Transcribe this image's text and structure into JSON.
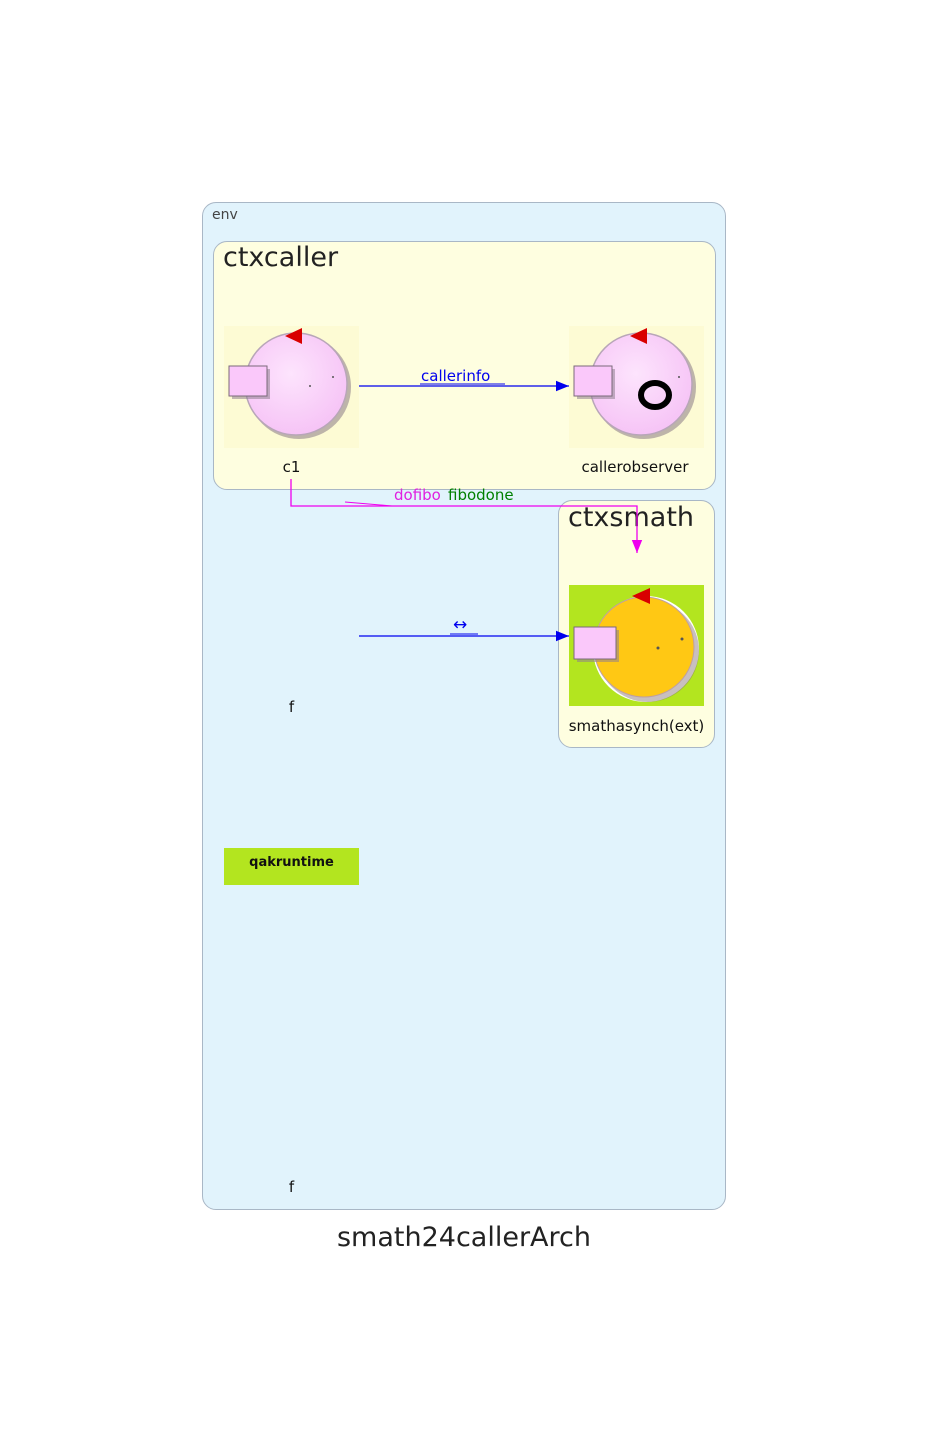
{
  "diagram": {
    "title": "smath24callerArch",
    "env": {
      "label": "env"
    },
    "contexts": [
      {
        "id": "ctxcaller",
        "label": "ctxcaller"
      },
      {
        "id": "ctxsmath",
        "label": "ctxsmath"
      }
    ],
    "nodes": {
      "c1": {
        "label": "c1"
      },
      "callerobserver": {
        "label": "callerobserver"
      },
      "smathasynch": {
        "label": "smathasynch(ext)"
      },
      "f1": {
        "label": "f"
      },
      "f2": {
        "label": "f"
      },
      "qakruntime": {
        "label": "qakruntime"
      }
    },
    "edges": {
      "callerinfo": {
        "label": "callerinfo",
        "color": "#0000ee"
      },
      "dofibo": {
        "label": "dofibo",
        "color": "#e020e0"
      },
      "fibodone": {
        "label": "fibodone",
        "color": "#008000"
      },
      "f_to_smath": {
        "label": "↔",
        "color": "#0000ee"
      }
    },
    "colors": {
      "env": "#e1f3fc",
      "context": "#fefee0",
      "actor_pink": "#fac8fa",
      "actor_external": "#ffc814",
      "external_bg": "#b3e51f",
      "runtime": "#b3e51f"
    }
  }
}
